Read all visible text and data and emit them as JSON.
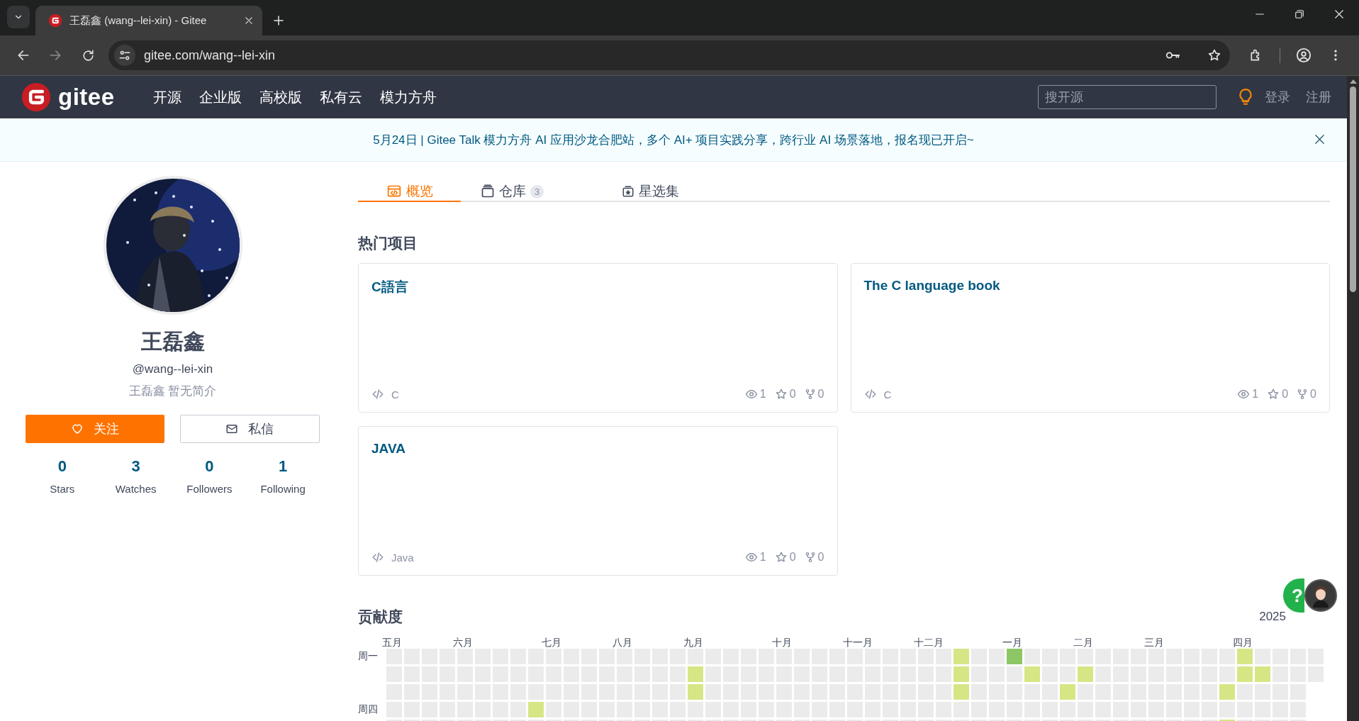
{
  "browser": {
    "tabs": [
      {
        "title": "王磊鑫 (wang--lei-xin) - Gitee",
        "selected": true
      }
    ],
    "address": "gitee.com/wang--lei-xin"
  },
  "header": {
    "logo": "gitee",
    "nav": [
      "开源",
      "企业版",
      "高校版",
      "私有云",
      "模力方舟"
    ],
    "search": {
      "placeholder": "搜开源"
    },
    "links": [
      "登录",
      "注册"
    ]
  },
  "banner": {
    "text": "5月24日 | Gitee Talk 模力方舟 AI 应用沙龙合肥站，多个 AI+ 项目实践分享，跨行业 AI 场景落地，报名现已开启~"
  },
  "profile": {
    "name": "王磊鑫",
    "handle": "@wang--lei-xin",
    "bio": "王磊鑫 暂无简介",
    "buttons": [
      {
        "label": "关注",
        "kind": "primary"
      },
      {
        "label": "私信",
        "kind": "secondary"
      }
    ],
    "stats": [
      {
        "value": "0",
        "label": "Stars"
      },
      {
        "value": "3",
        "label": "Watches"
      },
      {
        "value": "0",
        "label": "Followers"
      },
      {
        "value": "1",
        "label": "Following"
      }
    ]
  },
  "tabs": [
    {
      "label": "概览",
      "selected": true
    },
    {
      "label": "仓库",
      "count": "3",
      "selected": false
    },
    {
      "label": "星选集",
      "selected": false
    }
  ],
  "popular": {
    "title": "热门项目",
    "projects": [
      {
        "name": "C語言",
        "language": "C",
        "watches": "1",
        "stars": "0",
        "forks": "0"
      },
      {
        "name": "The C language book",
        "language": "C",
        "watches": "1",
        "stars": "0",
        "forks": "0"
      },
      {
        "name": "JAVA",
        "language": "Java",
        "watches": "1",
        "stars": "0",
        "forks": "0"
      }
    ]
  },
  "contributions": {
    "title": "贡献度",
    "year": "2025",
    "weeks": [
      {
        "month": "五月",
        "days": [
          {
            "color": "#ebebeb",
            "weekday": "周一"
          },
          {
            "color": "#ebebeb"
          },
          {
            "color": "#ebebeb"
          },
          {
            "color": "#ebebeb",
            "weekday": "周四"
          },
          {
            "color": "#ebebeb"
          }
        ]
      },
      {
        "days": [
          {
            "color": "#ebebeb"
          },
          {
            "color": "#ebebeb"
          },
          {
            "color": "#ebebeb"
          },
          {
            "color": "#ebebeb"
          },
          {
            "color": "#ebebeb"
          }
        ]
      },
      {
        "days": [
          {
            "color": "#ebebeb"
          },
          {
            "color": "#ebebeb"
          },
          {
            "color": "#ebebeb"
          },
          {
            "color": "#ebebeb"
          },
          {
            "color": "#ebebeb"
          }
        ]
      },
      {
        "days": [
          {
            "color": "#ebebeb"
          },
          {
            "color": "#ebebeb"
          },
          {
            "color": "#ebebeb"
          },
          {
            "color": "#ebebeb"
          },
          {
            "color": "#ebebeb"
          }
        ]
      },
      {
        "month": "六月",
        "days": [
          {
            "color": "#ebebeb"
          },
          {
            "color": "#ebebeb"
          },
          {
            "color": "#ebebeb"
          },
          {
            "color": "#ebebeb"
          },
          {
            "color": "#ebebeb"
          }
        ]
      },
      {
        "days": [
          {
            "color": "#ebebeb"
          },
          {
            "color": "#ebebeb"
          },
          {
            "color": "#ebebeb"
          },
          {
            "color": "#ebebeb"
          },
          {
            "color": "#ebebeb"
          }
        ]
      },
      {
        "days": [
          {
            "color": "#ebebeb"
          },
          {
            "color": "#ebebeb"
          },
          {
            "color": "#ebebeb"
          },
          {
            "color": "#ebebeb"
          },
          {
            "color": "#ebebeb"
          }
        ]
      },
      {
        "days": [
          {
            "color": "#ebebeb"
          },
          {
            "color": "#ebebeb"
          },
          {
            "color": "#ebebeb"
          },
          {
            "color": "#ebebeb"
          },
          {
            "color": "#ebebeb"
          }
        ]
      },
      {
        "days": [
          {
            "color": "#ebebeb"
          },
          {
            "color": "#ebebeb"
          },
          {
            "color": "#ebebeb"
          },
          {
            "color": "#d6e685"
          },
          {
            "color": "#ebebeb"
          }
        ]
      },
      {
        "month": "七月",
        "days": [
          {
            "color": "#ebebeb"
          },
          {
            "color": "#ebebeb"
          },
          {
            "color": "#ebebeb"
          },
          {
            "color": "#ebebeb"
          },
          {
            "color": "#ebebeb"
          }
        ]
      },
      {
        "days": [
          {
            "color": "#ebebeb"
          },
          {
            "color": "#ebebeb"
          },
          {
            "color": "#ebebeb"
          },
          {
            "color": "#ebebeb"
          },
          {
            "color": "#ebebeb"
          }
        ]
      },
      {
        "days": [
          {
            "color": "#ebebeb"
          },
          {
            "color": "#ebebeb"
          },
          {
            "color": "#ebebeb"
          },
          {
            "color": "#ebebeb"
          },
          {
            "color": "#ebebeb"
          }
        ]
      },
      {
        "days": [
          {
            "color": "#ebebeb"
          },
          {
            "color": "#ebebeb"
          },
          {
            "color": "#ebebeb"
          },
          {
            "color": "#ebebeb"
          },
          {
            "color": "#ebebeb"
          }
        ]
      },
      {
        "month": "八月",
        "days": [
          {
            "color": "#ebebeb"
          },
          {
            "color": "#ebebeb"
          },
          {
            "color": "#ebebeb"
          },
          {
            "color": "#ebebeb"
          },
          {
            "color": "#ebebeb"
          }
        ]
      },
      {
        "days": [
          {
            "color": "#ebebeb"
          },
          {
            "color": "#ebebeb"
          },
          {
            "color": "#ebebeb"
          },
          {
            "color": "#ebebeb"
          },
          {
            "color": "#ebebeb"
          }
        ]
      },
      {
        "days": [
          {
            "color": "#ebebeb"
          },
          {
            "color": "#ebebeb"
          },
          {
            "color": "#ebebeb"
          },
          {
            "color": "#ebebeb"
          },
          {
            "color": "#ebebeb"
          }
        ]
      },
      {
        "days": [
          {
            "color": "#ebebeb"
          },
          {
            "color": "#ebebeb"
          },
          {
            "color": "#ebebeb"
          },
          {
            "color": "#ebebeb"
          },
          {
            "color": "#ebebeb"
          }
        ]
      },
      {
        "month": "九月",
        "days": [
          {
            "color": "#ebebeb"
          },
          {
            "color": "#d6e685"
          },
          {
            "color": "#d6e685"
          },
          {
            "color": "#ebebeb"
          },
          {
            "color": "#ebebeb"
          }
        ]
      },
      {
        "days": [
          {
            "color": "#ebebeb"
          },
          {
            "color": "#ebebeb"
          },
          {
            "color": "#ebebeb"
          },
          {
            "color": "#ebebeb"
          },
          {
            "color": "#ebebeb"
          }
        ]
      },
      {
        "days": [
          {
            "color": "#ebebeb"
          },
          {
            "color": "#ebebeb"
          },
          {
            "color": "#ebebeb"
          },
          {
            "color": "#ebebeb"
          },
          {
            "color": "#ebebeb"
          }
        ]
      },
      {
        "days": [
          {
            "color": "#ebebeb"
          },
          {
            "color": "#ebebeb"
          },
          {
            "color": "#ebebeb"
          },
          {
            "color": "#ebebeb"
          },
          {
            "color": "#ebebeb"
          }
        ]
      },
      {
        "days": [
          {
            "color": "#ebebeb"
          },
          {
            "color": "#ebebeb"
          },
          {
            "color": "#ebebeb"
          },
          {
            "color": "#ebebeb"
          },
          {
            "color": "#ebebeb"
          }
        ]
      },
      {
        "month": "十月",
        "days": [
          {
            "color": "#ebebeb"
          },
          {
            "color": "#ebebeb"
          },
          {
            "color": "#ebebeb"
          },
          {
            "color": "#ebebeb"
          },
          {
            "color": "#ebebeb"
          }
        ]
      },
      {
        "days": [
          {
            "color": "#ebebeb"
          },
          {
            "color": "#ebebeb"
          },
          {
            "color": "#ebebeb"
          },
          {
            "color": "#ebebeb"
          },
          {
            "color": "#ebebeb"
          }
        ]
      },
      {
        "days": [
          {
            "color": "#ebebeb"
          },
          {
            "color": "#ebebeb"
          },
          {
            "color": "#ebebeb"
          },
          {
            "color": "#ebebeb"
          },
          {
            "color": "#ebebeb"
          }
        ]
      },
      {
        "days": [
          {
            "color": "#ebebeb"
          },
          {
            "color": "#ebebeb"
          },
          {
            "color": "#ebebeb"
          },
          {
            "color": "#ebebeb"
          },
          {
            "color": "#ebebeb"
          }
        ]
      },
      {
        "month": "十一月",
        "days": [
          {
            "color": "#ebebeb"
          },
          {
            "color": "#ebebeb"
          },
          {
            "color": "#ebebeb"
          },
          {
            "color": "#ebebeb"
          },
          {
            "color": "#ebebeb"
          }
        ]
      },
      {
        "days": [
          {
            "color": "#ebebeb"
          },
          {
            "color": "#ebebeb"
          },
          {
            "color": "#ebebeb"
          },
          {
            "color": "#ebebeb"
          },
          {
            "color": "#ebebeb"
          }
        ]
      },
      {
        "days": [
          {
            "color": "#ebebeb"
          },
          {
            "color": "#ebebeb"
          },
          {
            "color": "#ebebeb"
          },
          {
            "color": "#ebebeb"
          },
          {
            "color": "#ebebeb"
          }
        ]
      },
      {
        "days": [
          {
            "color": "#ebebeb"
          },
          {
            "color": "#ebebeb"
          },
          {
            "color": "#ebebeb"
          },
          {
            "color": "#ebebeb"
          },
          {
            "color": "#ebebeb"
          }
        ]
      },
      {
        "month": "十二月",
        "days": [
          {
            "color": "#ebebeb"
          },
          {
            "color": "#ebebeb"
          },
          {
            "color": "#ebebeb"
          },
          {
            "color": "#ebebeb"
          },
          {
            "color": "#ebebeb"
          }
        ]
      },
      {
        "days": [
          {
            "color": "#ebebeb"
          },
          {
            "color": "#ebebeb"
          },
          {
            "color": "#ebebeb"
          },
          {
            "color": "#ebebeb"
          },
          {
            "color": "#ebebeb"
          }
        ]
      },
      {
        "days": [
          {
            "color": "#d6e685"
          },
          {
            "color": "#d6e685"
          },
          {
            "color": "#d6e685"
          },
          {
            "color": "#ebebeb"
          },
          {
            "color": "#ebebeb"
          }
        ]
      },
      {
        "days": [
          {
            "color": "#ebebeb"
          },
          {
            "color": "#ebebeb"
          },
          {
            "color": "#ebebeb"
          },
          {
            "color": "#ebebeb"
          },
          {
            "color": "#ebebeb"
          }
        ]
      },
      {
        "days": [
          {
            "color": "#ebebeb"
          },
          {
            "color": "#ebebeb"
          },
          {
            "color": "#ebebeb"
          },
          {
            "color": "#ebebeb"
          },
          {
            "color": "#ebebeb"
          }
        ]
      },
      {
        "month": "一月",
        "days": [
          {
            "color": "#8cc665"
          },
          {
            "color": "#ebebeb"
          },
          {
            "color": "#ebebeb"
          },
          {
            "color": "#ebebeb"
          },
          {
            "color": "#ebebeb"
          }
        ]
      },
      {
        "days": [
          {
            "color": "#ebebeb"
          },
          {
            "color": "#d6e685"
          },
          {
            "color": "#ebebeb"
          },
          {
            "color": "#ebebeb"
          },
          {
            "color": "#ebebeb"
          }
        ]
      },
      {
        "days": [
          {
            "color": "#ebebeb"
          },
          {
            "color": "#ebebeb"
          },
          {
            "color": "#ebebeb"
          },
          {
            "color": "#ebebeb"
          },
          {
            "color": "#ebebeb"
          }
        ]
      },
      {
        "days": [
          {
            "color": "#ebebeb"
          },
          {
            "color": "#ebebeb"
          },
          {
            "color": "#d6e685"
          },
          {
            "color": "#ebebeb"
          },
          {
            "color": "#ebebeb"
          }
        ]
      },
      {
        "month": "二月",
        "days": [
          {
            "color": "#ebebeb"
          },
          {
            "color": "#d6e685"
          },
          {
            "color": "#ebebeb"
          },
          {
            "color": "#ebebeb"
          },
          {
            "color": "#ebebeb"
          }
        ]
      },
      {
        "days": [
          {
            "color": "#ebebeb"
          },
          {
            "color": "#ebebeb"
          },
          {
            "color": "#ebebeb"
          },
          {
            "color": "#ebebeb"
          },
          {
            "color": "#ebebeb"
          }
        ]
      },
      {
        "days": [
          {
            "color": "#ebebeb"
          },
          {
            "color": "#ebebeb"
          },
          {
            "color": "#ebebeb"
          },
          {
            "color": "#ebebeb"
          },
          {
            "color": "#ebebeb"
          }
        ]
      },
      {
        "days": [
          {
            "color": "#ebebeb"
          },
          {
            "color": "#ebebeb"
          },
          {
            "color": "#ebebeb"
          },
          {
            "color": "#ebebeb"
          },
          {
            "color": "#ebebeb"
          }
        ]
      },
      {
        "month": "三月",
        "days": [
          {
            "color": "#ebebeb"
          },
          {
            "color": "#ebebeb"
          },
          {
            "color": "#ebebeb"
          },
          {
            "color": "#ebebeb"
          },
          {
            "color": "#ebebeb"
          }
        ]
      },
      {
        "days": [
          {
            "color": "#ebebeb"
          },
          {
            "color": "#ebebeb"
          },
          {
            "color": "#ebebeb"
          },
          {
            "color": "#ebebeb"
          },
          {
            "color": "#ebebeb"
          }
        ]
      },
      {
        "days": [
          {
            "color": "#ebebeb"
          },
          {
            "color": "#ebebeb"
          },
          {
            "color": "#ebebeb"
          },
          {
            "color": "#ebebeb"
          },
          {
            "color": "#ebebeb"
          }
        ]
      },
      {
        "days": [
          {
            "color": "#ebebeb"
          },
          {
            "color": "#ebebeb"
          },
          {
            "color": "#ebebeb"
          },
          {
            "color": "#ebebeb"
          },
          {
            "color": "#ebebeb"
          }
        ]
      },
      {
        "days": [
          {
            "color": "#ebebeb"
          },
          {
            "color": "#ebebeb"
          },
          {
            "color": "#d6e685"
          },
          {
            "color": "#ebebeb"
          },
          {
            "color": "#d6e685"
          }
        ]
      },
      {
        "month": "四月",
        "days": [
          {
            "color": "#d6e685"
          },
          {
            "color": "#d6e685"
          },
          {
            "color": "#ebebeb"
          },
          {
            "color": "#ebebeb"
          },
          {
            "color": "#ebebeb"
          }
        ]
      },
      {
        "days": [
          {
            "color": "#ebebeb"
          },
          {
            "color": "#d6e685"
          },
          {
            "color": "#ebebeb"
          },
          {
            "color": "#ebebeb"
          },
          {
            "color": "#ebebeb"
          }
        ]
      },
      {
        "days": [
          {
            "color": "#ebebeb"
          },
          {
            "color": "#ebebeb"
          },
          {
            "color": "#ebebeb"
          },
          {
            "color": "#ebebeb"
          },
          {
            "color": "#ebebeb"
          }
        ]
      },
      {
        "days": [
          {
            "color": "#ebebeb"
          },
          {
            "color": "#ebebeb"
          },
          {
            "color": "#ebebeb"
          },
          {
            "color": "#ebebeb"
          },
          {
            "color": "#ebebeb"
          }
        ]
      },
      {
        "days": [
          {
            "color": "#ebebeb"
          },
          {
            "color": "#ebebeb"
          }
        ]
      }
    ]
  },
  "help": {
    "label": "?"
  }
}
